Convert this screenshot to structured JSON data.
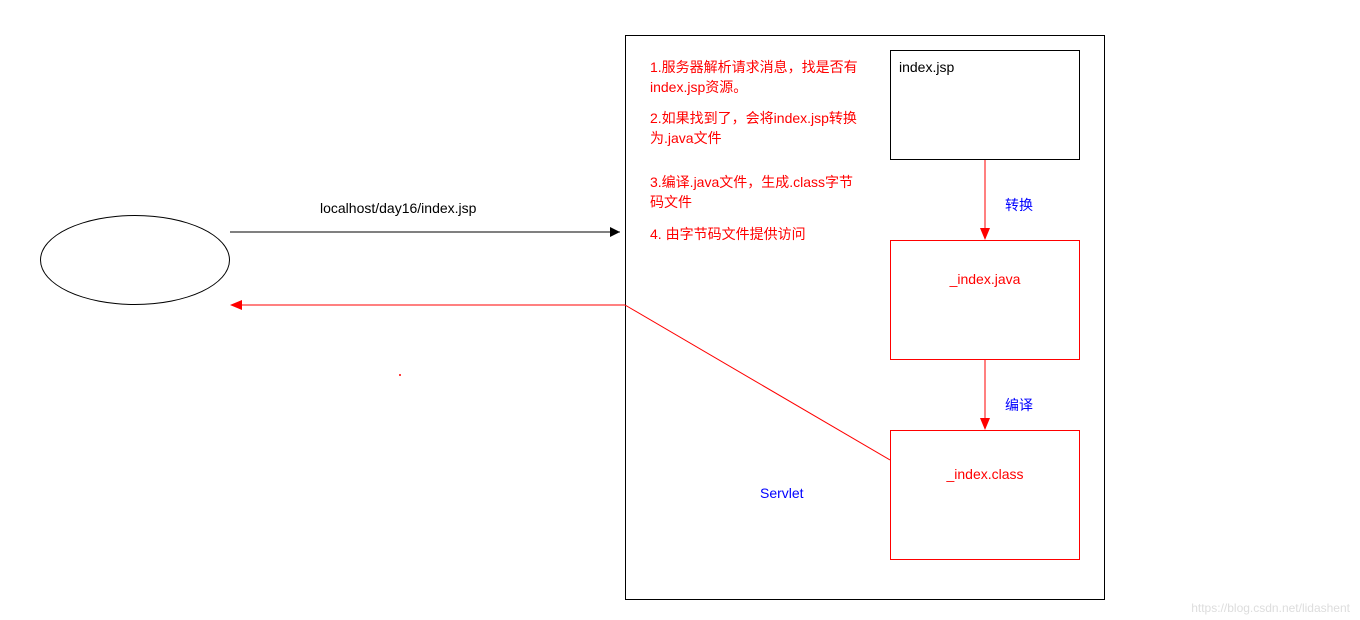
{
  "request_url": "localhost/day16/index.jsp",
  "steps": {
    "s1": "1.服务器解析请求消息，找是否有index.jsp资源。",
    "s2": "2.如果找到了，会将index.jsp转换为.java文件",
    "s3": "3.编译.java文件，生成.class字节码文件",
    "s4": "4. 由字节码文件提供访问"
  },
  "boxes": {
    "jsp": "index.jsp",
    "java": "_index.java",
    "class": "_index.class"
  },
  "arrows": {
    "convert": "转换",
    "compile": "编译"
  },
  "servlet_label": "Servlet",
  "watermark": "https://blog.csdn.net/lidashent"
}
